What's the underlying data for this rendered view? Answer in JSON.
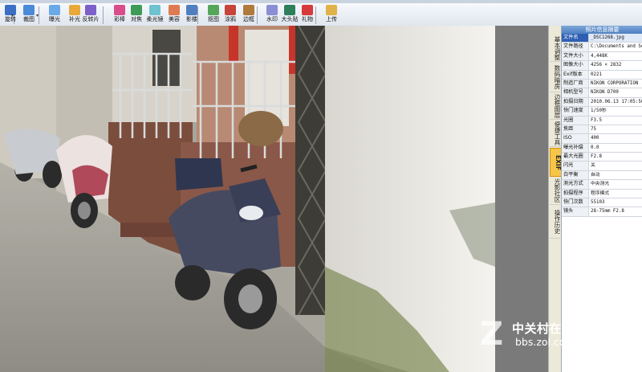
{
  "toolbar": {
    "tools": [
      {
        "label": "旋转",
        "icon": "rotate-icon",
        "color": "#3a6fc4"
      },
      {
        "label": "裁图",
        "icon": "crop-icon",
        "color": "#4b8ad8"
      },
      {
        "label": "曝光",
        "icon": "exposure-icon",
        "color": "#6aa9e8"
      },
      {
        "label": "补光",
        "icon": "fill-light-icon",
        "color": "#e8a93a"
      },
      {
        "label": "反转片",
        "icon": "reversal-film-icon",
        "color": "#7c5fc9"
      },
      {
        "label": "彩棒",
        "icon": "color-wand-icon",
        "color": "#d94d8a"
      },
      {
        "label": "对焦",
        "icon": "focus-icon",
        "color": "#3c9c55"
      },
      {
        "label": "柔光镜",
        "icon": "soft-lens-icon",
        "color": "#6fc2d0"
      },
      {
        "label": "美容",
        "icon": "beauty-icon",
        "color": "#e07a52"
      },
      {
        "label": "影楼",
        "icon": "studio-icon",
        "color": "#4f7fc0"
      },
      {
        "label": "抠图",
        "icon": "cutout-icon",
        "color": "#55a65a"
      },
      {
        "label": "涂鸦",
        "icon": "doodle-icon",
        "color": "#c6453b"
      },
      {
        "label": "边框",
        "icon": "frame-icon",
        "color": "#b07a3c"
      },
      {
        "label": "水印",
        "icon": "watermark-icon",
        "color": "#8a8ed3"
      },
      {
        "label": "大头贴",
        "icon": "sticker-icon",
        "color": "#2f7f5c"
      },
      {
        "label": "礼物",
        "icon": "gift-icon",
        "color": "#d63a3a"
      },
      {
        "label": "上传",
        "icon": "upload-icon",
        "color": "#e0b24a"
      }
    ]
  },
  "side_tabs": [
    "基本调整",
    "数码暗房",
    "边框图层",
    "便捷工具",
    "EXIF",
    "光影社区",
    "操作历史"
  ],
  "exif": {
    "title": "照片信息摘要",
    "rows": [
      {
        "k": "文件名",
        "v": "_DSC1268.jpg"
      },
      {
        "k": "文件路径",
        "v": "C:\\Documents and Setti"
      },
      {
        "k": "文件大小",
        "v": "4,448K"
      },
      {
        "k": "图像大小",
        "v": "4256 × 2832"
      },
      {
        "k": "Exif版本",
        "v": "0221"
      },
      {
        "k": "制造厂商",
        "v": "NIKON CORPORATION"
      },
      {
        "k": "相机型号",
        "v": "NIKON D700"
      },
      {
        "k": "拍摄日期",
        "v": "2010.06.13 17:05:50"
      },
      {
        "k": "快门速度",
        "v": "1/50秒"
      },
      {
        "k": "光圈",
        "v": "F3.5"
      },
      {
        "k": "焦距",
        "v": "75"
      },
      {
        "k": "ISO",
        "v": "400"
      },
      {
        "k": "曝光补偿",
        "v": "0.0"
      },
      {
        "k": "最大光圈",
        "v": "F2.8"
      },
      {
        "k": "闪光",
        "v": "关"
      },
      {
        "k": "白平衡",
        "v": "自动"
      },
      {
        "k": "测光方式",
        "v": "中央测光"
      },
      {
        "k": "拍摄程序",
        "v": "程序模式"
      },
      {
        "k": "快门次数",
        "v": "55103"
      },
      {
        "k": "镜头",
        "v": "28-75mm F2.8"
      }
    ]
  },
  "watermark": {
    "brand": "中关村在线论坛",
    "url": "bbs.zol.com.cn"
  },
  "colors": {
    "accent": "#2f5fb3",
    "active_tab": "#f7c54a"
  }
}
